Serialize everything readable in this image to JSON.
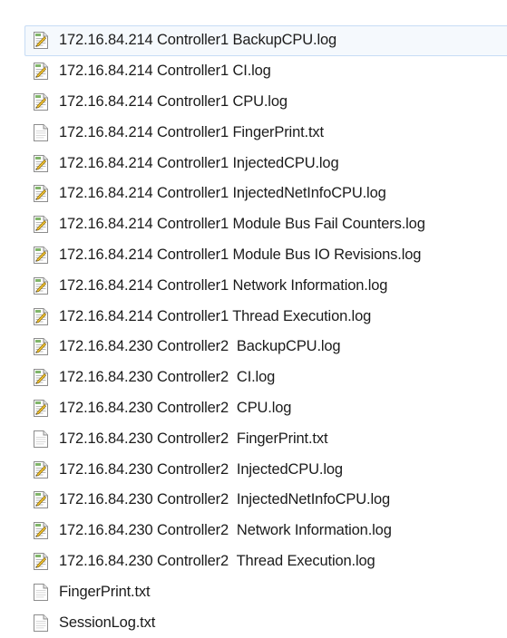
{
  "files": [
    {
      "name": "172.16.84.214 Controller1 BackupCPU.log",
      "icon": "log-file-icon",
      "selected": true
    },
    {
      "name": "172.16.84.214 Controller1 CI.log",
      "icon": "log-file-icon"
    },
    {
      "name": "172.16.84.214 Controller1 CPU.log",
      "icon": "log-file-icon"
    },
    {
      "name": "172.16.84.214 Controller1 FingerPrint.txt",
      "icon": "text-file-icon"
    },
    {
      "name": "172.16.84.214 Controller1 InjectedCPU.log",
      "icon": "log-file-icon"
    },
    {
      "name": "172.16.84.214 Controller1 InjectedNetInfoCPU.log",
      "icon": "log-file-icon"
    },
    {
      "name": "172.16.84.214 Controller1 Module Bus Fail Counters.log",
      "icon": "log-file-icon"
    },
    {
      "name": "172.16.84.214 Controller1 Module Bus IO Revisions.log",
      "icon": "log-file-icon"
    },
    {
      "name": "172.16.84.214 Controller1 Network Information.log",
      "icon": "log-file-icon"
    },
    {
      "name": "172.16.84.214 Controller1 Thread Execution.log",
      "icon": "log-file-icon"
    },
    {
      "name": "172.16.84.230 Controller2  BackupCPU.log",
      "icon": "log-file-icon"
    },
    {
      "name": "172.16.84.230 Controller2  CI.log",
      "icon": "log-file-icon"
    },
    {
      "name": "172.16.84.230 Controller2  CPU.log",
      "icon": "log-file-icon"
    },
    {
      "name": "172.16.84.230 Controller2  FingerPrint.txt",
      "icon": "text-file-icon"
    },
    {
      "name": "172.16.84.230 Controller2  InjectedCPU.log",
      "icon": "log-file-icon"
    },
    {
      "name": "172.16.84.230 Controller2  InjectedNetInfoCPU.log",
      "icon": "log-file-icon"
    },
    {
      "name": "172.16.84.230 Controller2  Network Information.log",
      "icon": "log-file-icon"
    },
    {
      "name": "172.16.84.230 Controller2  Thread Execution.log",
      "icon": "log-file-icon"
    },
    {
      "name": "FingerPrint.txt",
      "icon": "text-file-icon"
    },
    {
      "name": "SessionLog.txt",
      "icon": "text-file-icon"
    }
  ],
  "colors": {
    "selection_fill": "#f5f9fd",
    "selection_border": "#c7dcf5",
    "log_icon_accent": "#6aa84f",
    "text": "#1b1b1b"
  }
}
